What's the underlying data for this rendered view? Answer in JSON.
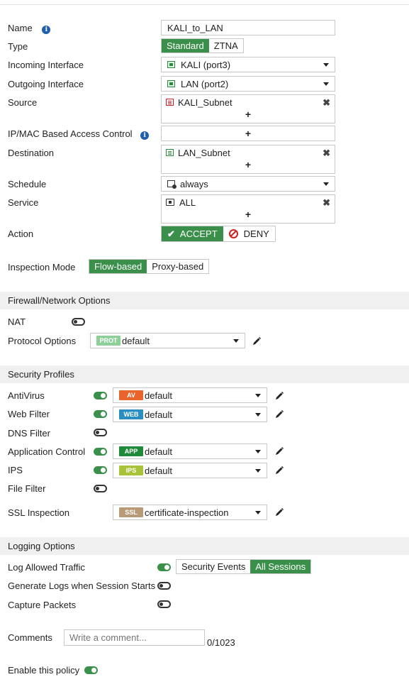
{
  "form": {
    "name": {
      "label": "Name",
      "value": "KALI_to_LAN"
    },
    "type": {
      "label": "Type",
      "options": [
        "Standard",
        "ZTNA"
      ],
      "selected": "Standard"
    },
    "incoming": {
      "label": "Incoming Interface",
      "value": "KALI (port3)",
      "icon": "interface-icon"
    },
    "outgoing": {
      "label": "Outgoing Interface",
      "value": "LAN (port2)",
      "icon": "interface-icon"
    },
    "source": {
      "label": "Source",
      "items": [
        "KALI_Subnet"
      ],
      "add": "+"
    },
    "ipmac": {
      "label": "IP/MAC Based Access Control",
      "add": "+"
    },
    "destination": {
      "label": "Destination",
      "items": [
        "LAN_Subnet"
      ],
      "add": "+"
    },
    "schedule": {
      "label": "Schedule",
      "value": "always"
    },
    "service": {
      "label": "Service",
      "items": [
        "ALL"
      ],
      "add": "+"
    },
    "action": {
      "label": "Action",
      "accept": "ACCEPT",
      "deny": "DENY",
      "selected": "ACCEPT"
    },
    "inspection": {
      "label": "Inspection Mode",
      "options": [
        "Flow-based",
        "Proxy-based"
      ],
      "selected": "Flow-based"
    }
  },
  "firewall": {
    "title": "Firewall/Network Options",
    "nat": {
      "label": "NAT",
      "enabled": false
    },
    "protocol": {
      "label": "Protocol Options",
      "badge": "PROT",
      "value": "default"
    }
  },
  "security": {
    "title": "Security Profiles",
    "antivirus": {
      "label": "AntiVirus",
      "enabled": true,
      "badge": "AV",
      "value": "default"
    },
    "webfilter": {
      "label": "Web Filter",
      "enabled": true,
      "badge": "WEB",
      "value": "default"
    },
    "dnsfilter": {
      "label": "DNS Filter",
      "enabled": false
    },
    "appcontrol": {
      "label": "Application Control",
      "enabled": true,
      "badge": "APP",
      "value": "default"
    },
    "ips": {
      "label": "IPS",
      "enabled": true,
      "badge": "IPS",
      "value": "default"
    },
    "filefilter": {
      "label": "File Filter",
      "enabled": false
    },
    "ssl": {
      "label": "SSL Inspection",
      "badge": "SSL",
      "value": "certificate-inspection"
    }
  },
  "logging": {
    "title": "Logging Options",
    "allowed": {
      "label": "Log Allowed Traffic",
      "enabled": true,
      "options": [
        "Security Events",
        "All Sessions"
      ],
      "selected": "All Sessions"
    },
    "sessionstart": {
      "label": "Generate Logs when Session Starts",
      "enabled": false
    },
    "capture": {
      "label": "Capture Packets",
      "enabled": false
    }
  },
  "comments": {
    "label": "Comments",
    "placeholder": "Write a comment...",
    "counter": "0/1023"
  },
  "enable": {
    "label": "Enable this policy",
    "enabled": true
  },
  "colors": {
    "accent": "#3a8f4a",
    "av": "#e8642a",
    "web": "#2a8fc0",
    "app": "#1e8a3a",
    "ips": "#a8c23a",
    "prot": "#8fcf9a",
    "ssl": "#b89a76"
  }
}
